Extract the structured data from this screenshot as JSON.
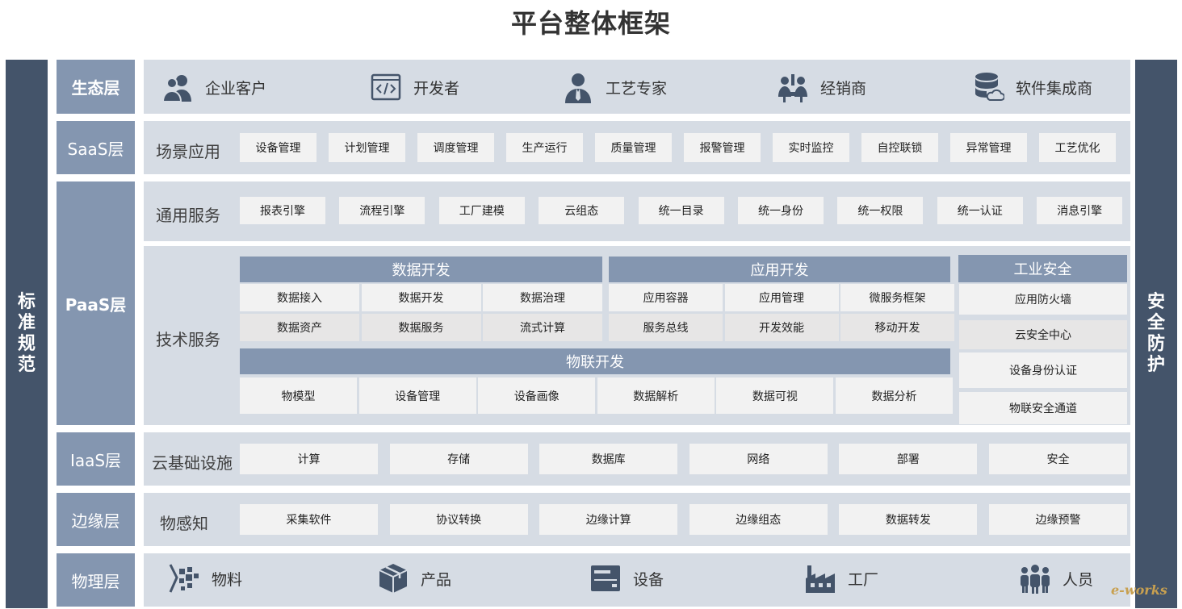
{
  "title": "平台整体框架",
  "side_left": "标准规范",
  "side_right": "安全防护",
  "layers": {
    "eco": "生态层",
    "saas": "SaaS层",
    "paas": "PaaS层",
    "iaas": "IaaS层",
    "edge": "边缘层",
    "phys": "物理层"
  },
  "eco_items": [
    "企业客户",
    "开发者",
    "工艺专家",
    "经销商",
    "软件集成商"
  ],
  "saas": {
    "label": "场景应用",
    "items": [
      "设备管理",
      "计划管理",
      "调度管理",
      "生产运行",
      "质量管理",
      "报警管理",
      "实时监控",
      "自控联锁",
      "异常管理",
      "工艺优化"
    ]
  },
  "paas_common": {
    "label": "通用服务",
    "items": [
      "报表引擎",
      "流程引擎",
      "工厂建模",
      "云组态",
      "统一目录",
      "统一身份",
      "统一权限",
      "统一认证",
      "消息引擎"
    ]
  },
  "paas_tech": {
    "label": "技术服务",
    "data_dev": {
      "header": "数据开发",
      "row1": [
        "数据接入",
        "数据开发",
        "数据治理"
      ],
      "row2": [
        "数据资产",
        "数据服务",
        "流式计算"
      ]
    },
    "app_dev": {
      "header": "应用开发",
      "row1": [
        "应用容器",
        "应用管理",
        "微服务框架"
      ],
      "row2": [
        "服务总线",
        "开发效能",
        "移动开发"
      ]
    },
    "iot_dev": {
      "header": "物联开发",
      "items": [
        "物模型",
        "设备管理",
        "设备画像",
        "数据解析",
        "数据可视",
        "数据分析"
      ]
    },
    "security": {
      "header": "工业安全",
      "items": [
        "应用防火墙",
        "云安全中心",
        "设备身份认证",
        "物联安全通道"
      ]
    }
  },
  "iaas": {
    "label": "云基础设施",
    "items": [
      "计算",
      "存储",
      "数据库",
      "网络",
      "部署",
      "安全"
    ]
  },
  "edge": {
    "label": "物感知",
    "items": [
      "采集软件",
      "协议转换",
      "边缘计算",
      "边缘组态",
      "数据转发",
      "边缘预警"
    ]
  },
  "phys_items": [
    "物料",
    "产品",
    "设备",
    "工厂",
    "人员"
  ],
  "watermark": "e-works",
  "colors": {
    "dark_side": "#44546a",
    "layer_label": "#8496b0",
    "band": "#d6dce4",
    "box": "#f2f2f2",
    "icon": "#44546a"
  },
  "icons": {
    "eco": [
      "users-icon",
      "code-icon",
      "expert-icon",
      "dealer-icon",
      "database-cloud-icon"
    ],
    "phys": [
      "material-icon",
      "box-icon",
      "device-icon",
      "factory-icon",
      "people-icon"
    ]
  }
}
